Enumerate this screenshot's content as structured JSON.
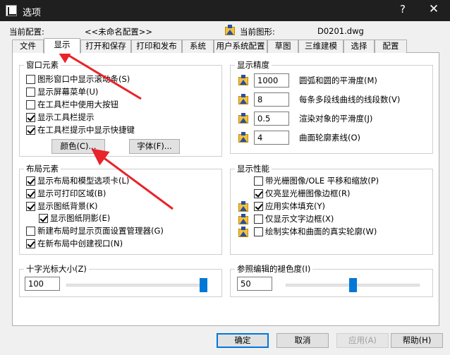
{
  "window": {
    "title": "选项",
    "help_label": "?",
    "close_label": "✕"
  },
  "profile": {
    "label": "当前配置:",
    "value": "<<未命名配置>>"
  },
  "drawing": {
    "label": "当前图形:",
    "value": "D0201.dwg"
  },
  "tabs": [
    "文件",
    "显示",
    "打开和保存",
    "打印和发布",
    "系统",
    "用户系统配置",
    "草图",
    "三维建模",
    "选择",
    "配置"
  ],
  "active_tab": "显示",
  "window_elements": {
    "title": "窗口元素",
    "items": [
      {
        "label": "图形窗口中显示滚动条(S)",
        "checked": false
      },
      {
        "label": "显示屏幕菜单(U)",
        "checked": false
      },
      {
        "label": "在工具栏中使用大按钮",
        "checked": false
      },
      {
        "label": "显示工具栏提示",
        "checked": true
      },
      {
        "label": "在工具栏提示中显示快捷键",
        "checked": true
      }
    ],
    "colors_button": "颜色(C)...",
    "fonts_button": "字体(F)..."
  },
  "display_resolution": {
    "title": "显示精度",
    "items": [
      {
        "value": "1000",
        "label": "圆弧和圆的平滑度(M)"
      },
      {
        "value": "8",
        "label": "每条多段线曲线的线段数(V)"
      },
      {
        "value": "0.5",
        "label": "渲染对象的平滑度(J)"
      },
      {
        "value": "4",
        "label": "曲面轮廓素线(O)"
      }
    ]
  },
  "layout_elements": {
    "title": "布局元素",
    "items": [
      {
        "label": "显示布局和模型选项卡(L)",
        "checked": true
      },
      {
        "label": "显示可打印区域(B)",
        "checked": true
      },
      {
        "label": "显示图纸背景(K)",
        "checked": true
      },
      {
        "label": "显示图纸阴影(E)",
        "checked": true
      },
      {
        "label": "新建布局时显示页面设置管理器(G)",
        "checked": false
      },
      {
        "label": "在新布局中创建视口(N)",
        "checked": true
      }
    ]
  },
  "display_performance": {
    "title": "显示性能",
    "items": [
      {
        "label": "带光栅图像/OLE 平移和缩放(P)",
        "checked": false,
        "icon": false
      },
      {
        "label": "仅亮显光栅图像边框(R)",
        "checked": true,
        "icon": false
      },
      {
        "label": "应用实体填充(Y)",
        "checked": true,
        "icon": true
      },
      {
        "label": "仅显示文字边框(X)",
        "checked": false,
        "icon": true
      },
      {
        "label": "绘制实体和曲面的真实轮廓(W)",
        "checked": false,
        "icon": true
      }
    ]
  },
  "crosshair": {
    "title": "十字光标大小(Z)",
    "value": "100",
    "slider_fraction": 1.0
  },
  "xref_fade": {
    "title": "参照编辑的褪色度(I)",
    "value": "50",
    "slider_fraction": 0.5
  },
  "footer": {
    "ok": "确定",
    "cancel": "取消",
    "apply": "应用(A)",
    "help": "帮助(H)"
  },
  "colors": {
    "accent": "#0078d7",
    "arrow": "#e8232a",
    "titlebar": "#1f1f1f"
  }
}
